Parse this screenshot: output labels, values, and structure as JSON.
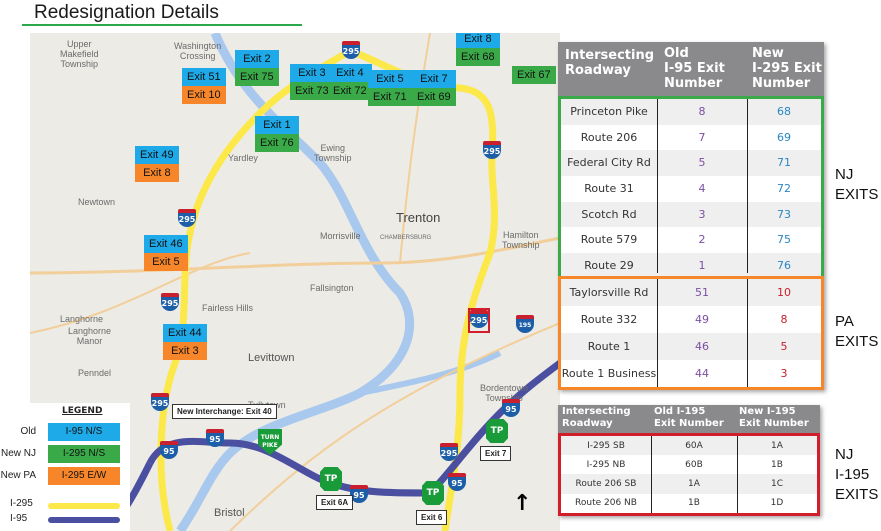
{
  "title": "Redesignation Details",
  "map": {
    "places": [
      {
        "name": "Upper Makefield Township",
        "lines": [
          "Upper",
          "Makefield",
          "Township"
        ]
      },
      {
        "name": "Washington Crossing",
        "lines": [
          "Washington",
          "Crossing"
        ]
      },
      {
        "name": "Yardley",
        "lines": [
          "Yardley"
        ]
      },
      {
        "name": "Ewing Township",
        "lines": [
          "Ewing",
          "Township"
        ]
      },
      {
        "name": "Newtown",
        "lines": [
          "Newtown"
        ]
      },
      {
        "name": "Trenton",
        "lines": [
          "Trenton"
        ]
      },
      {
        "name": "Chambersburg",
        "lines": [
          "CHAMBERSBURG"
        ]
      },
      {
        "name": "Morrisville",
        "lines": [
          "Morrisville"
        ]
      },
      {
        "name": "Hamilton Township",
        "lines": [
          "Hamilton",
          "Township"
        ]
      },
      {
        "name": "Fallsington",
        "lines": [
          "Fallsington"
        ]
      },
      {
        "name": "Fairless Hills",
        "lines": [
          "Fairless Hills"
        ]
      },
      {
        "name": "Langhorne",
        "lines": [
          "Langhorne"
        ]
      },
      {
        "name": "Langhorne Manor",
        "lines": [
          "Langhorne",
          "Manor"
        ]
      },
      {
        "name": "Levittown",
        "lines": [
          "Levittown"
        ]
      },
      {
        "name": "Penndel",
        "lines": [
          "Penndel"
        ]
      },
      {
        "name": "Tullytown",
        "lines": [
          "Tullytown"
        ]
      },
      {
        "name": "Bordentown Township",
        "lines": [
          "Bordentown",
          "Township"
        ]
      },
      {
        "name": "Bristol",
        "lines": [
          "Bristol"
        ]
      }
    ],
    "exit_labels": [
      {
        "old": "Exit 2",
        "new": "Exit 75",
        "type": "nj"
      },
      {
        "old": "Exit 3",
        "new": "Exit 73",
        "type": "nj"
      },
      {
        "old": "Exit 4",
        "new": "Exit 72",
        "type": "nj"
      },
      {
        "old": "Exit 5",
        "new": "Exit 71",
        "type": "nj"
      },
      {
        "old": "Exit 7",
        "new": "Exit 69",
        "type": "nj"
      },
      {
        "old": "Exit 8",
        "new": "Exit 68",
        "type": "nj"
      },
      {
        "old": null,
        "new": "Exit 67",
        "type": "nj"
      },
      {
        "old": "Exit 1",
        "new": "Exit 76",
        "type": "nj"
      },
      {
        "old": "Exit 51",
        "new": "Exit 10",
        "type": "pa"
      },
      {
        "old": "Exit 49",
        "new": "Exit 8",
        "type": "pa"
      },
      {
        "old": "Exit 46",
        "new": "Exit 5",
        "type": "pa"
      },
      {
        "old": "Exit 44",
        "new": "Exit 3",
        "type": "pa"
      }
    ],
    "callouts": {
      "new_interchange": "New Interchange:  Exit 40",
      "exit_6a": "Exit 6A",
      "exit_6": "Exit 6",
      "exit_7": "Exit 7"
    },
    "shields": {
      "i295": "295",
      "i95": "95",
      "i195": "195",
      "turnpike": "TURN PIKE",
      "nj_tp": "TP"
    },
    "north_arrow": "↑"
  },
  "legend": {
    "title": "LEGEND",
    "items": [
      {
        "label": "Old",
        "swatch": "I-95 N/S",
        "color": "#1ea9e8"
      },
      {
        "label": "New NJ",
        "swatch": "I-295 N/S",
        "color": "#3aaa49"
      },
      {
        "label": "New PA",
        "swatch": "I-295 E/W",
        "color": "#f7862a"
      }
    ],
    "lines": [
      {
        "label": "I-295",
        "color": "#fde84a"
      },
      {
        "label": "I-95",
        "color": "#4a4fa0"
      }
    ]
  },
  "table_main": {
    "headers": [
      "Intersecting Roadway",
      "Old I-95 Exit Number",
      "New I-295 Exit Number"
    ],
    "header_lines": [
      [
        "Intersecting",
        "Roadway"
      ],
      [
        "Old",
        "I-95 Exit",
        "Number"
      ],
      [
        "New",
        "I-295 Exit",
        "Number"
      ]
    ],
    "nj_rows": [
      {
        "road": "Princeton Pike",
        "old": "8",
        "new": "68"
      },
      {
        "road": "Route 206",
        "old": "7",
        "new": "69"
      },
      {
        "road": "Federal City Rd",
        "old": "5",
        "new": "71"
      },
      {
        "road": "Route 31",
        "old": "4",
        "new": "72"
      },
      {
        "road": "Scotch Rd",
        "old": "3",
        "new": "73"
      },
      {
        "road": "Route 579",
        "old": "2",
        "new": "75"
      },
      {
        "road": "Route 29",
        "old": "1",
        "new": "76"
      }
    ],
    "pa_rows": [
      {
        "road": "Taylorsville Rd",
        "old": "51",
        "new": "10"
      },
      {
        "road": "Route 332",
        "old": "49",
        "new": "8"
      },
      {
        "road": "Route 1",
        "old": "46",
        "new": "5"
      },
      {
        "road": "Route 1 Business",
        "old": "44",
        "new": "3"
      }
    ],
    "nj_label": [
      "NJ",
      "EXITS"
    ],
    "pa_label": [
      "PA",
      "EXITS"
    ]
  },
  "table_i195": {
    "header_lines": [
      [
        "Intersecting",
        "Roadway"
      ],
      [
        "Old I-195",
        "Exit Number"
      ],
      [
        "New I-195",
        "Exit Number"
      ]
    ],
    "rows": [
      {
        "road": "I-295 SB",
        "old": "60A",
        "new": "1A"
      },
      {
        "road": "I-295 NB",
        "old": "60B",
        "new": "1B"
      },
      {
        "road": "Route 206 SB",
        "old": "1A",
        "new": "1C"
      },
      {
        "road": "Route 206 NB",
        "old": "1B",
        "new": "1D"
      }
    ],
    "label": [
      "NJ",
      "I-195",
      "EXITS"
    ]
  },
  "colors": {
    "nj_green": "#3aaa49",
    "pa_orange": "#f7862a",
    "i195_red": "#d01f2b",
    "old_blue": "#1ea9e8",
    "header_gray": "#8a8a8c"
  }
}
